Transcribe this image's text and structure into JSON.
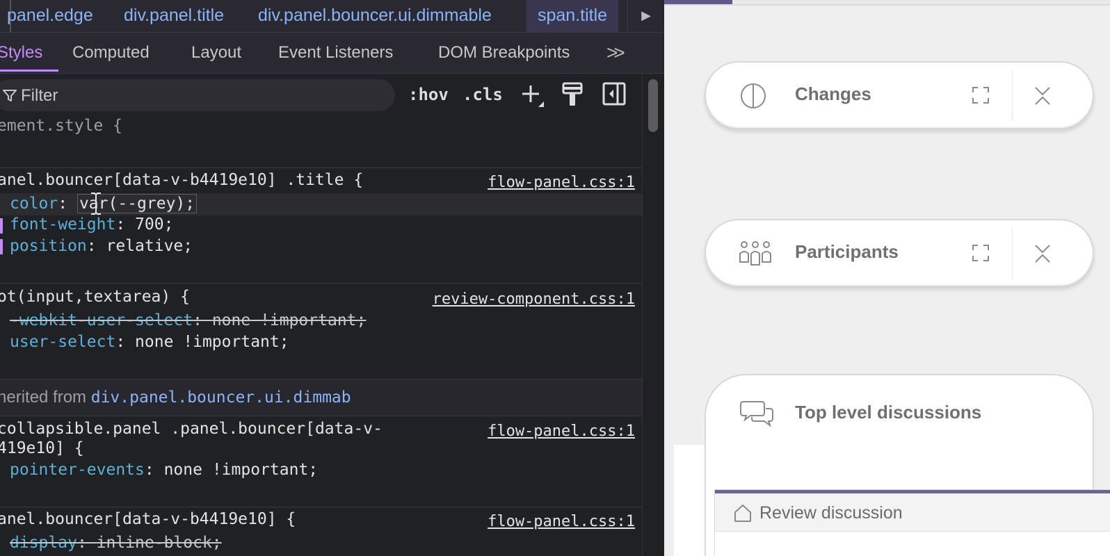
{
  "breadcrumbs": {
    "items": [
      "panel.edge",
      "div.panel.title",
      "div.panel.bouncer.ui.dimmable",
      "span.title"
    ],
    "selected_index": 3
  },
  "tabs": [
    "Styles",
    "Computed",
    "Layout",
    "Event Listeners",
    "DOM Breakpoints"
  ],
  "active_tab": "Styles",
  "more_tabs": ">>",
  "filter": {
    "placeholder": "Filter",
    "value": ""
  },
  "filter_buttons": {
    "hov": ":hov",
    "cls": ".cls",
    "add": "+"
  },
  "rules": {
    "element_style": "ement.style {",
    "rule1": {
      "selector": "anel.bouncer[data-v-b4419e10] .title {",
      "source": "flow-panel.css:1",
      "decls": [
        {
          "prop": "color",
          "value": "var(--grey);"
        },
        {
          "prop": "font-weight",
          "value": "700;"
        },
        {
          "prop": "position",
          "value": "relative;"
        }
      ]
    },
    "rule2": {
      "selector": "ot(input,textarea) {",
      "source": "review-component.css:1",
      "decls": [
        {
          "prop": "-webkit-user-select",
          "value": "none !important;"
        },
        {
          "prop": "user-select",
          "value": "none !important;"
        }
      ]
    },
    "inherited": {
      "label": "herited from",
      "link": "div.panel.bouncer.ui.dimmab"
    },
    "rule3": {
      "selector_line1": "collapsible.panel .panel.bouncer[data-v-",
      "selector_line2": "419e10] {",
      "source": "flow-panel.css:1",
      "decls": [
        {
          "prop": "pointer-events",
          "value": "none !important;"
        }
      ]
    },
    "rule4": {
      "selector": "anel.bouncer[data-v-b4419e10] {",
      "source": "flow-panel.css:1",
      "decls": [
        {
          "prop": "display",
          "value": "inline-block;"
        }
      ]
    }
  },
  "app": {
    "panels": [
      {
        "title": "Changes",
        "icon": "half-circle-icon"
      },
      {
        "title": "Participants",
        "icon": "participants-icon"
      }
    ],
    "discussions_title": "Top level discussions",
    "review_label": "Review discussion",
    "accent_color": "#6b6598"
  },
  "colors": {
    "devtools_bg": "#202124",
    "css_property": "#5db0d7",
    "link": "#8ab4f8",
    "active_tab": "#c58af9"
  }
}
